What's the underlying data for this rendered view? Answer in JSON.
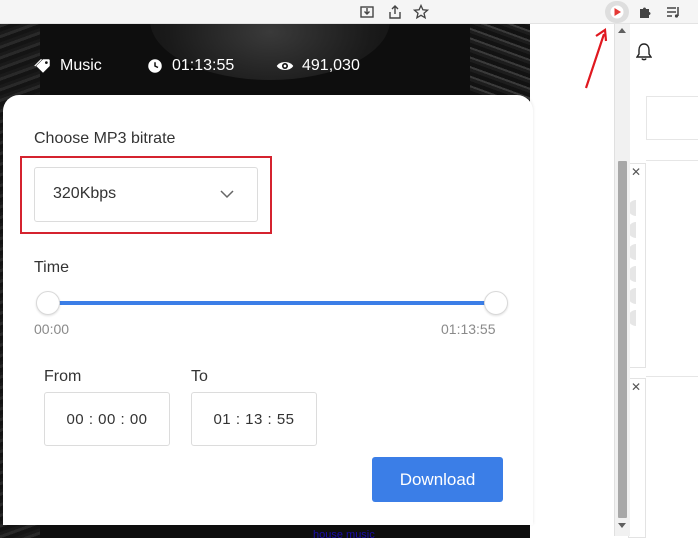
{
  "video_meta": {
    "category": "Music",
    "duration": "01:13:55",
    "views": "491,030"
  },
  "popup": {
    "bitrate_label": "Choose MP3 bitrate",
    "bitrate_selected": "320Kbps",
    "time_label": "Time",
    "range_start": "00:00",
    "range_end": "01:13:55",
    "from_label": "From",
    "to_label": "To",
    "from_value": "00 : 00 : 00",
    "to_value": "01 : 13 : 55",
    "download_label": "Download"
  },
  "page": {
    "link_text": "house music"
  },
  "colors": {
    "accent": "#3b7ee7",
    "highlight": "#d5232f",
    "extension_icon": "#e53935"
  }
}
